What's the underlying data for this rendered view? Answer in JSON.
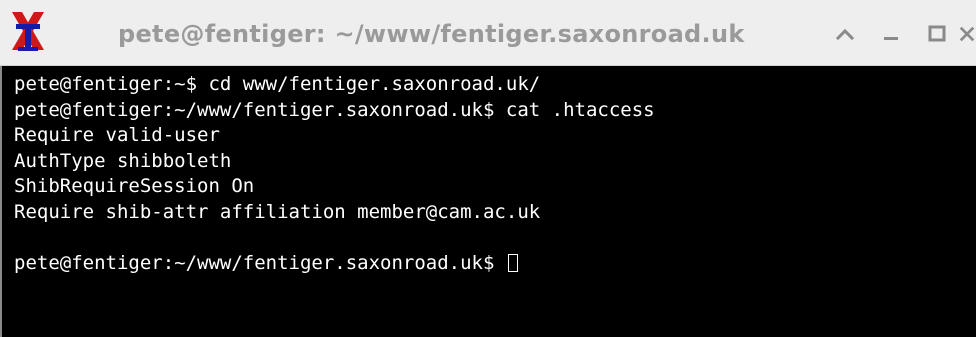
{
  "window": {
    "title": "pete@fentiger: ~/www/fentiger.saxonroad.uk",
    "app_icon": "x-terminal-icon",
    "controls": [
      "chevron-up-icon",
      "minimize-icon",
      "maximize-icon",
      "close-icon"
    ]
  },
  "terminal": {
    "lines": [
      "pete@fentiger:~$ cd www/fentiger.saxonroad.uk/",
      "pete@fentiger:~/www/fentiger.saxonroad.uk$ cat .htaccess",
      "Require valid-user",
      "AuthType shibboleth",
      "ShibRequireSession On",
      "Require shib-attr affiliation member@cam.ac.uk",
      "",
      "pete@fentiger:~/www/fentiger.saxonroad.uk$ "
    ],
    "colors": {
      "background": "#000000",
      "foreground": "#ffffff"
    }
  },
  "colors": {
    "titlebar_bg": "#eeeeee",
    "title_text": "#9a9a9a",
    "icon_red": "#d01818",
    "icon_blue": "#1a1aa8"
  }
}
